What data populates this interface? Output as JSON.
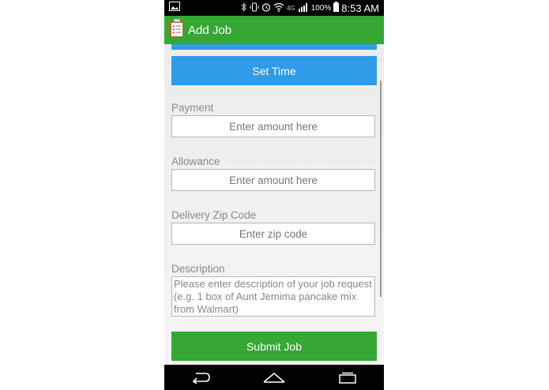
{
  "status_bar": {
    "network": "4G",
    "battery": "100%",
    "time": "8:53 AM"
  },
  "app_bar": {
    "title": "Add Job"
  },
  "form": {
    "set_time_label": "Set Time",
    "payment": {
      "label": "Payment",
      "placeholder": "Enter amount here"
    },
    "allowance": {
      "label": "Allowance",
      "placeholder": "Enter amount here"
    },
    "zip": {
      "label": "Delivery Zip Code",
      "placeholder": "Enter zip code"
    },
    "description": {
      "label": "Description",
      "placeholder": "Please enter description of your job request (e.g. 1 box of Aunt Jemima pancake mix from Walmart)"
    },
    "submit_label": "Submit Job"
  },
  "icons": {
    "app": "clipboard-checklist-icon",
    "nav_back": "back-icon",
    "nav_home": "home-icon",
    "nav_recent": "recent-apps-icon"
  },
  "colors": {
    "app_bar": "#34a832",
    "primary_button": "#2f9be9",
    "submit_button": "#34a832"
  }
}
